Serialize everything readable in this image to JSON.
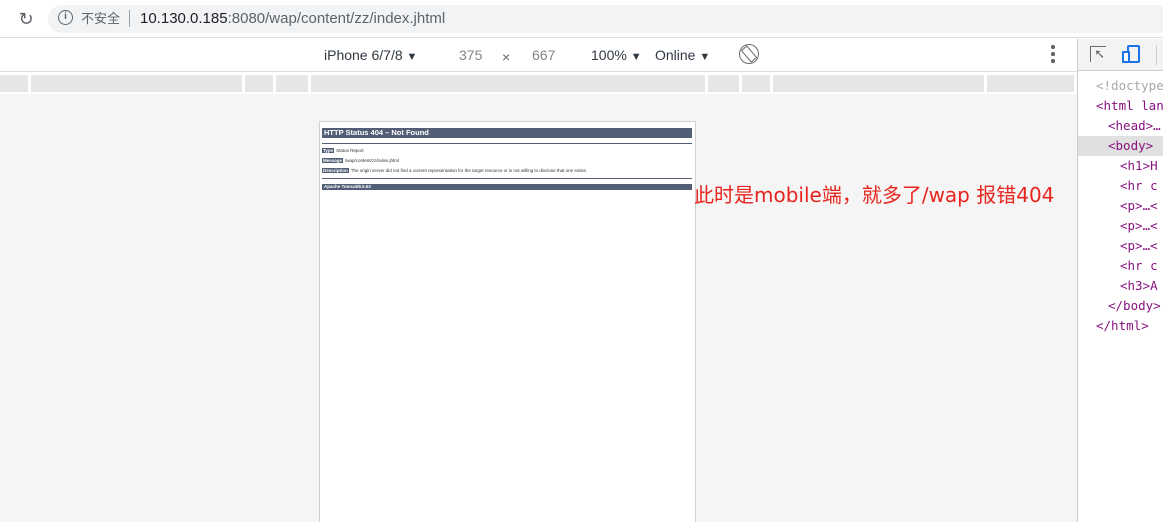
{
  "browser": {
    "reload_icon": "reload-icon",
    "security_label": "不安全",
    "url_host": "10.130.0.185",
    "url_rest": ":8080/wap/content/zz/index.jhtml"
  },
  "device_toolbar": {
    "device": "iPhone 6/7/8",
    "width": "375",
    "times": "×",
    "height": "667",
    "zoom": "100%",
    "network": "Online"
  },
  "tomcat_page": {
    "title": "HTTP Status 404 – Not Found",
    "type_label": "Type",
    "type_value": "Status Report",
    "message_label": "Message",
    "message_value": "/wap/content/zz/index.jhtml",
    "description_label": "Description",
    "description_value": "The origin server did not find a current representation for the target resource or is not willing to disclose that one exists.",
    "footer": "Apache Tomcat/8.5.53"
  },
  "annotation": "此时是mobile端，就多了/wap 报错404",
  "devtools": {
    "lines": [
      {
        "indent": 0,
        "text": "<!doctype",
        "style": "gray"
      },
      {
        "indent": 0,
        "text": "<html lan",
        "style": "tag"
      },
      {
        "indent": 1,
        "toggle": "▶",
        "text": "<head>…",
        "style": "tag"
      },
      {
        "indent": 1,
        "toggle": "▼",
        "text": "<body>",
        "style": "tag",
        "selected": true
      },
      {
        "indent": 2,
        "text": "<h1>H",
        "style": "tag"
      },
      {
        "indent": 2,
        "text": "<hr c",
        "style": "tag"
      },
      {
        "indent": 2,
        "toggle": "▶",
        "text": "<p>…<",
        "style": "tag"
      },
      {
        "indent": 2,
        "toggle": "▶",
        "text": "<p>…<",
        "style": "tag"
      },
      {
        "indent": 2,
        "toggle": "▶",
        "text": "<p>…<",
        "style": "tag"
      },
      {
        "indent": 2,
        "text": "<hr c",
        "style": "tag"
      },
      {
        "indent": 2,
        "text": "<h3>A",
        "style": "tag"
      },
      {
        "indent": 1,
        "text": "</body>",
        "style": "tag"
      },
      {
        "indent": 0,
        "text": "</html>",
        "style": "tag"
      }
    ]
  }
}
